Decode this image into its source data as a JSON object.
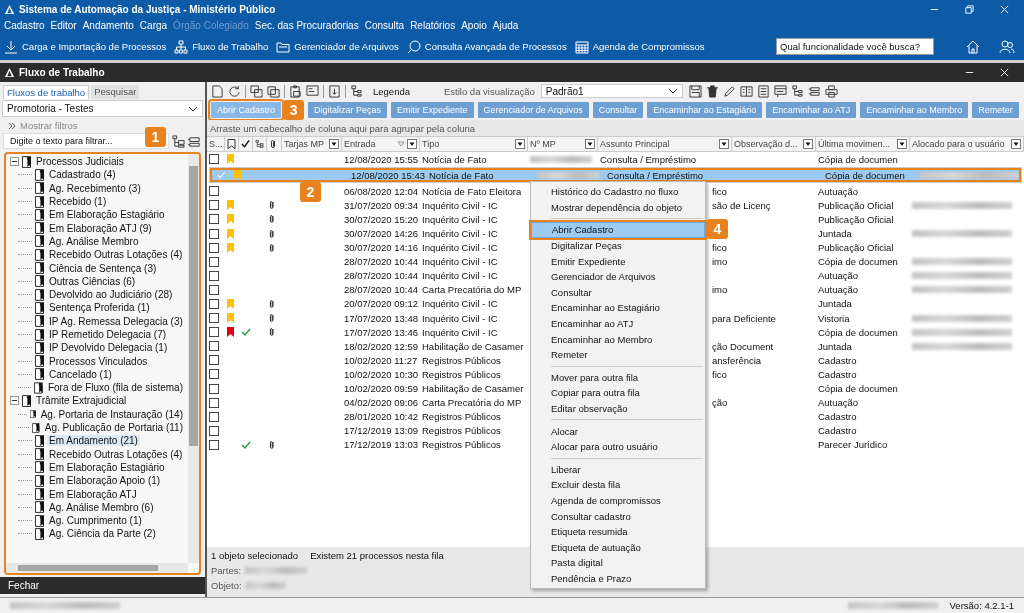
{
  "window": {
    "title": "Sistema de Automação da Justiça - Ministério Público"
  },
  "menu": [
    {
      "label": "Cadastro",
      "disabled": false
    },
    {
      "label": "Editor",
      "disabled": false
    },
    {
      "label": "Andamento",
      "disabled": false
    },
    {
      "label": "Carga",
      "disabled": false
    },
    {
      "label": "Órgão Colegiado",
      "disabled": true
    },
    {
      "label": "Sec. das Procuradorias",
      "disabled": false
    },
    {
      "label": "Consulta",
      "disabled": false
    },
    {
      "label": "Relatórios",
      "disabled": false
    },
    {
      "label": "Apoio",
      "disabled": false
    },
    {
      "label": "Ajuda",
      "disabled": false
    }
  ],
  "toolbar": [
    {
      "label": "Carga e Importação de Processos",
      "kind": "download"
    },
    {
      "label": "Fluxo de Trabalho",
      "kind": "orgchart"
    },
    {
      "label": "Gerenciador de Arquivos",
      "kind": "folder"
    },
    {
      "label": "Consulta Avançada de Processos",
      "kind": "search"
    },
    {
      "label": "Agenda de Compromissos",
      "kind": "calendar"
    }
  ],
  "search": {
    "placeholder": "Qual funcionalidade você busca?"
  },
  "panel": {
    "title": "Fluxo de Trabalho"
  },
  "left_tabs": [
    {
      "label": "Fluxos de trabalho",
      "selected": true
    },
    {
      "label": "Pesquisar",
      "selected": false
    }
  ],
  "workflow_select": {
    "value": "Promotoria - Testes"
  },
  "show_filters": "Mostrar filtros",
  "filter": {
    "placeholder": "Digite o texto para filtrar..."
  },
  "tree": [
    {
      "label": "Processos Judiciais",
      "expanded": true,
      "children": [
        {
          "label": "Cadastrado (4)",
          "selected": false
        },
        {
          "label": "Ag. Recebimento (3)",
          "selected": false
        },
        {
          "label": "Recebido (1)",
          "selected": false
        },
        {
          "label": "Em Elaboração Estagiário",
          "selected": false
        },
        {
          "label": "Em Elaboração ATJ (9)",
          "selected": false
        },
        {
          "label": "Ag. Análise Membro",
          "selected": false
        },
        {
          "label": "Recebido Outras Lotações (4)",
          "selected": false
        },
        {
          "label": "Ciência de Sentença (3)",
          "selected": false
        },
        {
          "label": "Outras Ciências (6)",
          "selected": false
        },
        {
          "label": "Devolvido ao Judiciário (28)",
          "selected": false
        },
        {
          "label": "Sentença Proferida (1)",
          "selected": false
        },
        {
          "label": "IP Ag. Remessa Delegacia (3)",
          "selected": false
        },
        {
          "label": "IP Remetido Delegacia (7)",
          "selected": false
        },
        {
          "label": "IP Devolvido Delegacia (1)",
          "selected": false
        },
        {
          "label": "Processos Vinculados",
          "selected": false
        },
        {
          "label": "Cancelado (1)",
          "selected": false
        },
        {
          "label": "Fora de Fluxo (fila de sistema)",
          "selected": false
        }
      ]
    },
    {
      "label": "Trâmite Extrajudicial",
      "expanded": true,
      "children": [
        {
          "label": "Ag. Portaria de Instauração (14)",
          "selected": false
        },
        {
          "label": "Ag. Publicação de Portaria (11)",
          "selected": false
        },
        {
          "label": "Em Andamento (21)",
          "selected": true
        },
        {
          "label": "Recebido Outras Lotações (4)",
          "selected": false
        },
        {
          "label": "Em Elaboração Estagiário",
          "selected": false
        },
        {
          "label": "Em Elaboração Apoio (1)",
          "selected": false
        },
        {
          "label": "Em Elaboração ATJ",
          "selected": false
        },
        {
          "label": "Ag. Análise Membro (6)",
          "selected": false
        },
        {
          "label": "Ag. Cumprimento (1)",
          "selected": false
        },
        {
          "label": "Ag. Ciência da Parte (2)",
          "selected": false
        }
      ]
    }
  ],
  "close_button": "Fechar",
  "legend": "Legenda",
  "view_style": {
    "label": "Estilo da visualização",
    "value": "Padrão1"
  },
  "actions": [
    "Abrir Cadastro",
    "Digitalizar Peças",
    "Emitir Expediente",
    "Gerenciador de Arquivos",
    "Consultar",
    "Encaminhar ao Estagiário",
    "Encaminhar ao ATJ",
    "Encaminhar ao Membro",
    "Remeter"
  ],
  "group_hint": "Arraste um cabecalho de coluna aqui para agrupar pela coluna",
  "columns": [
    {
      "label": "S...",
      "kind": "text"
    },
    {
      "kind": "flag"
    },
    {
      "kind": "check"
    },
    {
      "kind": "tree"
    },
    {
      "kind": "clip"
    },
    {
      "label": "Tarjas MP",
      "kind": "text",
      "filter": true
    },
    {
      "label": "Entrada",
      "kind": "sort",
      "filter": true
    },
    {
      "label": "Tipo",
      "kind": "text",
      "filter": true
    },
    {
      "label": "Nº MP",
      "kind": "text",
      "filter": true
    },
    {
      "label": "Assunto Principal",
      "kind": "text",
      "filter": true
    },
    {
      "label": "Observação d...",
      "kind": "text",
      "filter": true
    },
    {
      "label": "Última movimen...",
      "kind": "text",
      "filter": true
    },
    {
      "label": "Alocado para o usuário",
      "kind": "text",
      "filter": true
    }
  ],
  "rows": [
    {
      "checked": false,
      "selected": false,
      "color": "#ffc000",
      "entrada": "12/08/2020 15:55",
      "tipo": "Notícia de Fato",
      "mp_redacted": true,
      "assunto": "Consulta / Empréstimo",
      "covered": false,
      "ultima": "Cópia de documen"
    },
    {
      "checked": true,
      "selected": true,
      "color": "#ffc000",
      "entrada": "12/08/2020 15:43",
      "tipo": "Notícia de Fato",
      "mp_redacted": true,
      "assunto": "Consulta / Empréstimo",
      "covered": false,
      "ultima": "Cópia de documen",
      "alocado_redacted": true
    },
    {
      "checked": false,
      "selected": false,
      "entrada": "06/08/2020 12:04",
      "tipo": "Notícia de Fato Eleitora",
      "assunto": "fico",
      "covered": true,
      "ultima": "Autuação"
    },
    {
      "checked": false,
      "selected": false,
      "color": "#ffc000",
      "attachment": true,
      "entrada": "31/07/2020 09:34",
      "tipo": "Inquérito Civil - IC",
      "assunto": "são de Licenç",
      "covered": true,
      "ultima": "Publicação Oficial",
      "alocado_redacted": true
    },
    {
      "checked": false,
      "selected": false,
      "color": "#ffc000",
      "attachment": true,
      "entrada": "30/07/2020 15:20",
      "tipo": "Inquérito Civil - IC",
      "ultima": "Publicação Oficial"
    },
    {
      "checked": false,
      "selected": false,
      "color": "#ffc000",
      "attachment": true,
      "entrada": "30/07/2020 14:26",
      "tipo": "Inquérito Civil - IC",
      "ultima": "Juntada",
      "alocado_redacted": true
    },
    {
      "checked": false,
      "selected": false,
      "color": "#ffc000",
      "attachment": true,
      "entrada": "30/07/2020 14:16",
      "tipo": "Inquérito Civil - IC",
      "assunto": "fico",
      "covered": true,
      "ultima": "Publicação Oficial"
    },
    {
      "checked": false,
      "selected": false,
      "entrada": "28/07/2020 10:44",
      "tipo": "Inquérito Civil - IC",
      "assunto": "imo",
      "covered": true,
      "ultima": "Cópia de documen",
      "alocado_redacted": true
    },
    {
      "checked": false,
      "selected": false,
      "entrada": "28/07/2020 10:44",
      "tipo": "Inquérito Civil - IC",
      "ultima": "Autuação",
      "alocado_redacted": true
    },
    {
      "checked": false,
      "selected": false,
      "entrada": "28/07/2020 10:44",
      "tipo": "Carta Precatória do MP",
      "assunto": "imo",
      "covered": true,
      "ultima": "Autuação",
      "alocado_redacted": true
    },
    {
      "checked": false,
      "selected": false,
      "color": "#ffc000",
      "attachment": true,
      "entrada": "20/07/2020 09:12",
      "tipo": "Inquérito Civil - IC",
      "ultima": "Juntada"
    },
    {
      "checked": false,
      "selected": false,
      "color": "#ffc000",
      "attachment": true,
      "entrada": "17/07/2020 13:48",
      "tipo": "Inquérito Civil - IC",
      "assunto": "para Deficiente",
      "covered": true,
      "ultima": "Vistoria",
      "alocado_redacted": true
    },
    {
      "checked": false,
      "selected": false,
      "color": "#e0001b",
      "done": true,
      "attachment": true,
      "entrada": "17/07/2020 13:46",
      "tipo": "Inquérito Civil - IC",
      "ultima": "Cópia de documen",
      "alocado_redacted": true
    },
    {
      "checked": false,
      "selected": false,
      "entrada": "18/02/2020 12:59",
      "tipo": "Habilitação de Casamer",
      "assunto": "ção Document",
      "covered": true,
      "ultima": "Juntada",
      "alocado_redacted": true
    },
    {
      "checked": false,
      "selected": false,
      "entrada": "10/02/2020 11:27",
      "tipo": "Registros Públicos",
      "assunto": "ansferência",
      "covered": true,
      "ultima": "Cadastro"
    },
    {
      "checked": false,
      "selected": false,
      "entrada": "10/02/2020 10:30",
      "tipo": "Registros Públicos",
      "assunto": "fico",
      "covered": true,
      "ultima": "Cadastro"
    },
    {
      "checked": false,
      "selected": false,
      "entrada": "10/02/2020 09:59",
      "tipo": "Habilitação de Casamer",
      "ultima": "Cópia de documen"
    },
    {
      "checked": false,
      "selected": false,
      "entrada": "04/02/2020 09:06",
      "tipo": "Carta Precatória do MP",
      "assunto": "ção",
      "covered": true,
      "ultima": "Autuação"
    },
    {
      "checked": false,
      "selected": false,
      "entrada": "28/01/2020 10:42",
      "tipo": "Registros Públicos",
      "ultima": "Cadastro"
    },
    {
      "checked": false,
      "selected": false,
      "entrada": "17/12/2019 13:09",
      "tipo": "Registros Públicos",
      "ultima": "Cadastro"
    },
    {
      "checked": false,
      "selected": false,
      "done": true,
      "attachment": true,
      "entrada": "17/12/2019 13:03",
      "tipo": "Registros Públicos",
      "ultima": "Parecer Jurídico"
    }
  ],
  "context_menu": [
    [
      {
        "label": "Histórico do Cadastro no fluxo",
        "selected": false
      },
      {
        "label": "Mostrar dependência do objeto",
        "selected": false
      }
    ],
    [
      {
        "label": "Abrir Cadastro",
        "selected": true
      },
      {
        "label": "Digitalizar Peças",
        "selected": false
      },
      {
        "label": "Emitir Expediente",
        "selected": false
      },
      {
        "label": "Gerenciador de Arquivos",
        "selected": false
      },
      {
        "label": "Consultar",
        "selected": false
      },
      {
        "label": "Encaminhar ao Estagiário",
        "selected": false
      },
      {
        "label": "Encaminhar ao ATJ",
        "selected": false
      },
      {
        "label": "Encaminhar ao Membro",
        "selected": false
      },
      {
        "label": "Remeter",
        "selected": false
      }
    ],
    [
      {
        "label": "Mover para outra fila",
        "selected": false
      },
      {
        "label": "Copiar para outra fila",
        "selected": false
      },
      {
        "label": "Editar observação",
        "selected": false
      }
    ],
    [
      {
        "label": "Alocar",
        "selected": false
      },
      {
        "label": "Alocar para outro usuário",
        "selected": false
      }
    ],
    [
      {
        "label": "Liberar",
        "selected": false
      },
      {
        "label": "Excluir desta fila",
        "selected": false
      },
      {
        "label": "Agenda de compromissos",
        "selected": false
      },
      {
        "label": "Consultar cadastro",
        "selected": false
      },
      {
        "label": "Etiqueta resumida",
        "selected": false
      },
      {
        "label": "Etiqueta de autuação",
        "selected": false
      },
      {
        "label": "Pasta digital",
        "selected": false
      },
      {
        "label": "Pendência e Prazo",
        "selected": false
      }
    ]
  ],
  "status": {
    "selection": "1 objeto selecionado",
    "count": "Existem 21 processos nesta fila",
    "parties_label": "Partes:",
    "object_label": "Objeto:"
  },
  "version": "Versão: 4.2.1-1",
  "callouts": [
    {
      "number": "1",
      "kind": "tree"
    },
    {
      "number": "2",
      "kind": "row"
    },
    {
      "number": "3",
      "kind": "button"
    },
    {
      "number": "4",
      "kind": "menu_item"
    }
  ]
}
